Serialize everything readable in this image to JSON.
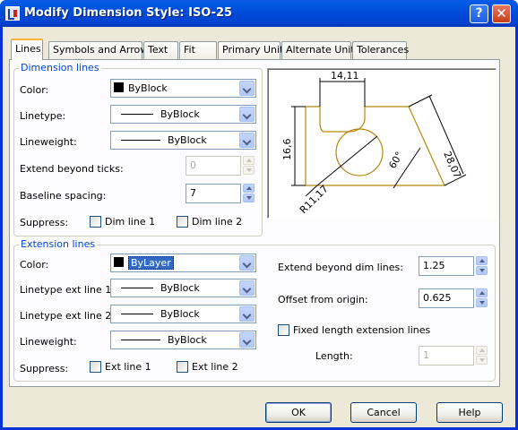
{
  "window": {
    "title": "Modify Dimension Style: ISO-25",
    "help_glyph": "?",
    "close_glyph": "✕"
  },
  "tabs": [
    {
      "label": "Lines",
      "active": true
    },
    {
      "label": "Symbols and Arrows"
    },
    {
      "label": "Text"
    },
    {
      "label": "Fit"
    },
    {
      "label": "Primary Units"
    },
    {
      "label": "Alternate Units"
    },
    {
      "label": "Tolerances"
    }
  ],
  "dimension_lines": {
    "title": "Dimension lines",
    "color_label": "Color:",
    "color_value": "ByBlock",
    "linetype_label": "Linetype:",
    "linetype_value": "ByBlock",
    "lineweight_label": "Lineweight:",
    "lineweight_value": "ByBlock",
    "extend_label": "Extend beyond ticks:",
    "extend_value": "0",
    "baseline_label": "Baseline spacing:",
    "baseline_value": "7",
    "suppress_label": "Suppress:",
    "dim_line_1": "Dim line 1",
    "dim_line_2": "Dim line 2"
  },
  "preview": {
    "dim_top": "14,11",
    "dim_left": "16,6",
    "dim_diag": "28,07",
    "angle": "60°",
    "radius": "R11,17"
  },
  "extension_lines": {
    "title": "Extension lines",
    "color_label": "Color:",
    "color_value": "ByLayer",
    "lt1_label": "Linetype ext line 1:",
    "lt1_value": "ByBlock",
    "lt2_label": "Linetype ext line 2:",
    "lt2_value": "ByBlock",
    "lineweight_label": "Lineweight:",
    "lineweight_value": "ByBlock",
    "suppress_label": "Suppress:",
    "ext_line_1": "Ext line 1",
    "ext_line_2": "Ext line 2",
    "extend_beyond_label": "Extend beyond dim lines:",
    "extend_beyond_value": "1.25",
    "offset_label": "Offset from origin:",
    "offset_value": "0.625",
    "fixed_length_label": "Fixed length extension lines",
    "length_label": "Length:",
    "length_value": "1"
  },
  "buttons": {
    "ok": "OK",
    "cancel": "Cancel",
    "help": "Help"
  },
  "colors": {
    "title_bar": "#0054e3",
    "group_title": "#0046d5",
    "selection": "#316ac5",
    "preview_geometry": "#b8860b"
  }
}
